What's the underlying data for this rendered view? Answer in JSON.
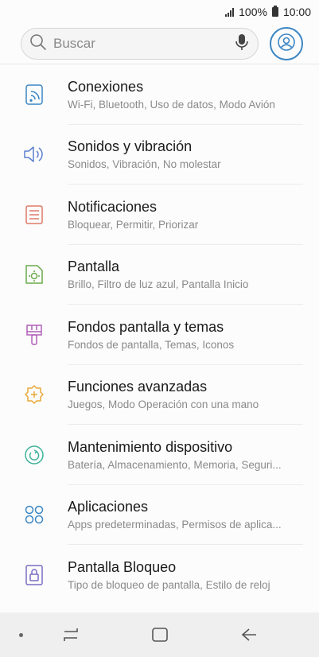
{
  "status": {
    "signal_text": "",
    "battery_pct": "100%",
    "time": "10:00"
  },
  "search": {
    "placeholder": "Buscar"
  },
  "settings": [
    {
      "title": "Conexiones",
      "subtitle": "Wi-Fi, Bluetooth, Uso de datos, Modo Avión",
      "icon": "connections-icon",
      "color": "#3b86c4"
    },
    {
      "title": "Sonidos y vibración",
      "subtitle": "Sonidos, Vibración, No molestar",
      "icon": "sound-icon",
      "color": "#5b7fd0"
    },
    {
      "title": "Notificaciones",
      "subtitle": "Bloquear, Permitir, Priorizar",
      "icon": "notifications-icon",
      "color": "#e07a6a"
    },
    {
      "title": "Pantalla",
      "subtitle": "Brillo, Filtro de luz azul, Pantalla Inicio",
      "icon": "display-icon",
      "color": "#6aaa4a"
    },
    {
      "title": "Fondos pantalla y temas",
      "subtitle": "Fondos de pantalla, Temas, Iconos",
      "icon": "themes-icon",
      "color": "#b060b8"
    },
    {
      "title": "Funciones avanzadas",
      "subtitle": "Juegos, Modo Operación con una mano",
      "icon": "advanced-features-icon",
      "color": "#e8a838"
    },
    {
      "title": "Mantenimiento dispositivo",
      "subtitle": "Batería, Almacenamiento, Memoria, Seguri...",
      "icon": "device-maintenance-icon",
      "color": "#3fb39a"
    },
    {
      "title": "Aplicaciones",
      "subtitle": "Apps predeterminadas, Permisos de aplica...",
      "icon": "apps-icon",
      "color": "#3b86c4"
    },
    {
      "title": "Pantalla Bloqueo",
      "subtitle": "Tipo de bloqueo de pantalla, Estilo de reloj",
      "icon": "lock-screen-icon",
      "color": "#7b6cc4"
    }
  ]
}
